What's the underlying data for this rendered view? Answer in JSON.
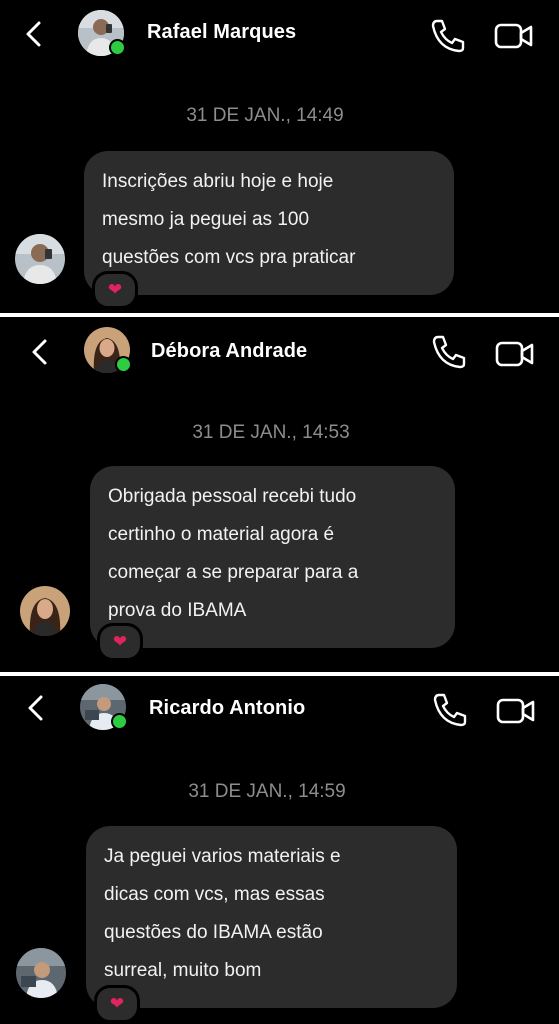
{
  "conversations": [
    {
      "contact_name": "Rafael Marques",
      "timestamp": "31 DE JAN., 14:49",
      "message_lines": [
        "Inscrições abriu hoje e hoje",
        "mesmo ja peguei as 100",
        "questões com vcs pra praticar"
      ],
      "reaction": "❤"
    },
    {
      "contact_name": "Débora Andrade",
      "timestamp": "31 DE JAN., 14:53",
      "message_lines": [
        "Obrigada pessoal recebi tudo",
        "certinho o material agora é",
        "começar a se preparar para a",
        "prova do IBAMA"
      ],
      "reaction": "❤"
    },
    {
      "contact_name": "Ricardo Antonio",
      "timestamp": "31 DE JAN., 14:59",
      "message_lines": [
        "Ja peguei varios materiais e",
        "dicas com vcs, mas essas",
        "questões do IBAMA estão",
        "surreal, muito bom"
      ],
      "reaction": "❤"
    }
  ],
  "icons": {
    "back": "chevron-left-icon",
    "call": "phone-icon",
    "video": "video-camera-icon",
    "reaction": "heart-icon"
  },
  "colors": {
    "background": "#000000",
    "bubble": "#2c2c2c",
    "timestamp": "#8d8d8d",
    "online": "#2ecc40",
    "heart": "#e0245e"
  }
}
